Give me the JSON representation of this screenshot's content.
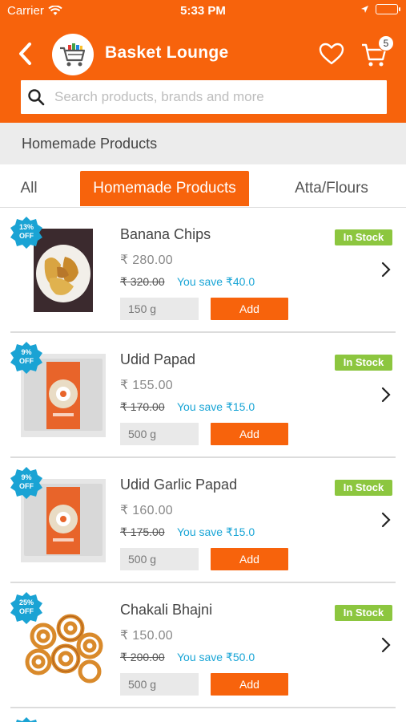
{
  "status_bar": {
    "carrier": "Carrier",
    "time": "5:33 PM"
  },
  "header": {
    "title": "Basket Lounge",
    "cart_count": "5"
  },
  "search": {
    "placeholder": "Search products, brands and more"
  },
  "section": {
    "title": "Homemade Products"
  },
  "tabs": [
    {
      "label": "All",
      "active": false
    },
    {
      "label": "Homemade Products",
      "active": true
    },
    {
      "label": "Atta/Flours",
      "active": false
    }
  ],
  "products": [
    {
      "name": "Banana Chips",
      "price": "₹ 280.00",
      "mrp": "₹ 320.00",
      "save": "You save ₹40.0",
      "discount": "13%",
      "off_label": "OFF",
      "stock": "In Stock",
      "qty": "150 g",
      "add_label": "Add"
    },
    {
      "name": "Udid Papad",
      "price": "₹ 155.00",
      "mrp": "₹ 170.00",
      "save": "You save ₹15.0",
      "discount": "9%",
      "off_label": "OFF",
      "stock": "In Stock",
      "qty": "500 g",
      "add_label": "Add"
    },
    {
      "name": "Udid Garlic Papad",
      "price": "₹ 160.00",
      "mrp": "₹ 175.00",
      "save": "You save ₹15.0",
      "discount": "9%",
      "off_label": "OFF",
      "stock": "In Stock",
      "qty": "500 g",
      "add_label": "Add"
    },
    {
      "name": "Chakali Bhajni",
      "price": "₹ 150.00",
      "mrp": "₹ 200.00",
      "save": "You save ₹50.0",
      "discount": "25%",
      "off_label": "OFF",
      "stock": "In Stock",
      "qty": "500 g",
      "add_label": "Add"
    }
  ],
  "colors": {
    "brand": "#f7630c",
    "in_stock": "#8cc63f",
    "save_text": "#19a5d6",
    "discount_badge": "#1aa3d4"
  },
  "icons": [
    "back-chevron-icon",
    "basket-logo-icon",
    "heart-icon",
    "cart-icon",
    "search-icon",
    "wifi-icon",
    "location-arrow-icon",
    "battery-icon",
    "chevron-right-icon"
  ]
}
